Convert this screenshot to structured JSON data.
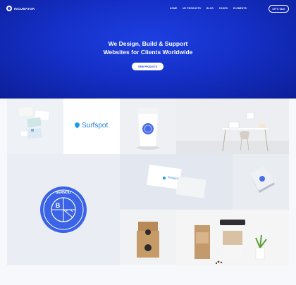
{
  "brand": {
    "name": "INCUBATOR",
    "logo_icon": "circle-logo-icon"
  },
  "nav": {
    "items": [
      "HOME",
      "MY PRODUCTS",
      "BLOG",
      "PAGES",
      "ELEMENTS"
    ],
    "cta": "LET'S TALK"
  },
  "hero": {
    "headline_line1": "We Design, Build & Support",
    "headline_line2": "Websites for Clients Worldwide",
    "button_label": "VIEW PRODUCTS"
  },
  "portfolio": {
    "surfspot_label": "Surfspot",
    "card_label": "Surfspot",
    "badge_top_text": "BERNOLI",
    "badge_letters": "B",
    "colors": {
      "accent": "#1d3fe0",
      "badge_blue": "#3a63e6",
      "surfspot_blue": "#1e7fd6"
    }
  }
}
